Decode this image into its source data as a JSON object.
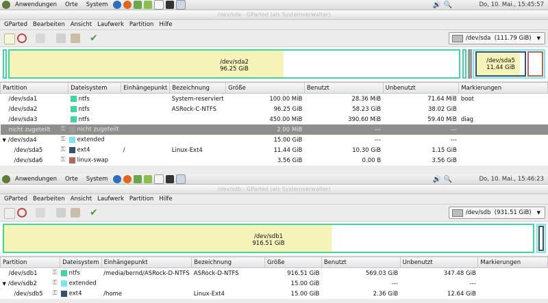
{
  "panel1": {
    "apps": "Anwendungen",
    "places": "Orte",
    "system": "System",
    "clock": "Do, 10. Mai., 15:45:57"
  },
  "window1": {
    "title": "/dev/sda - GParted (als Systemverwalter)",
    "menu": [
      "GParted",
      "Bearbeiten",
      "Ansicht",
      "Laufwerk",
      "Partition",
      "Hilfe"
    ],
    "device_selector": "/dev/sda",
    "device_size": "(111.79 GiB)",
    "disk_map": {
      "sda2_label": "/dev/sda2",
      "sda2_size": "96.25 GiB",
      "sda5_label": "/dev/sda5",
      "sda5_size": "11.44 GiB"
    },
    "columns": [
      "Partition",
      "Dateisystem",
      "Einhängepunkt",
      "Bezeichnung",
      "Größe",
      "Benutzt",
      "Unbenutzt",
      "Markierungen"
    ],
    "rows": [
      {
        "partition": "/dev/sda1",
        "fs": "ntfs",
        "fs_color": "#3ed89e",
        "mount": "",
        "label": "System-reserviert",
        "size": "100.00 MiB",
        "used": "28.36 MiB",
        "unused": "71.64 MiB",
        "flags": "boot"
      },
      {
        "partition": "/dev/sda2",
        "fs": "ntfs",
        "fs_color": "#3ed89e",
        "mount": "",
        "label": "ASRock-C-NTFS",
        "size": "96.25 GiB",
        "used": "58.23 GiB",
        "unused": "38.02 GiB",
        "flags": ""
      },
      {
        "partition": "/dev/sda3",
        "fs": "ntfs",
        "fs_color": "#3ed89e",
        "mount": "",
        "label": "",
        "size": "450.00 MiB",
        "used": "390.60 MiB",
        "unused": "59.40 MiB",
        "flags": "diag"
      },
      {
        "partition": "nicht zugeteilt",
        "fs": "nicht zugeteilt",
        "fs_color": "#9a9a96",
        "mount": "",
        "label": "",
        "size": "2.00 MiB",
        "used": "---",
        "unused": "---",
        "flags": ""
      },
      {
        "partition": "/dev/sda4",
        "fs": "extended",
        "fs_color": "#7be6f2",
        "mount": "",
        "label": "",
        "size": "15.00 GiB",
        "used": "---",
        "unused": "---",
        "flags": ""
      },
      {
        "partition": "/dev/sda5",
        "fs": "ext4",
        "fs_color": "#33506e",
        "mount": "/",
        "label": "Linux-Ext4",
        "size": "11.44 GiB",
        "used": "10.30 GiB",
        "unused": "1.15 GiB",
        "flags": ""
      },
      {
        "partition": "/dev/sda6",
        "fs": "linux-swap",
        "fs_color": "#b96458",
        "mount": "",
        "label": "",
        "size": "3.56 GiB",
        "used": "0.00 B",
        "unused": "3.56 GiB",
        "flags": ""
      }
    ]
  },
  "panel2": {
    "apps": "Anwendungen",
    "places": "Orte",
    "system": "System",
    "clock": "Do, 10. Mai., 15:46:23"
  },
  "window2": {
    "title": "/dev/sdb - GParted (als Systemverwalter)",
    "menu": [
      "GParted",
      "Bearbeiten",
      "Ansicht",
      "Laufwerk",
      "Partition",
      "Hilfe"
    ],
    "device_selector": "/dev/sdb",
    "device_size": "(931.51 GiB)",
    "disk_map": {
      "sdb1_label": "/dev/sdb1",
      "sdb1_size": "916.51 GiB"
    },
    "columns": [
      "Partition",
      "Dateisystem",
      "Einhängepunkt",
      "Bezeichnung",
      "Größe",
      "Benutzt",
      "Unbenutzt",
      "Markierungen"
    ],
    "rows": [
      {
        "partition": "/dev/sdb1",
        "fs": "ntfs",
        "fs_color": "#3ed89e",
        "mount": "/media/bernd/ASRock-D-NTFS",
        "label": "ASRock-D-NTFS",
        "size": "916.51 GiB",
        "used": "569.03 GiB",
        "unused": "347.48 GiB",
        "flags": ""
      },
      {
        "partition": "/dev/sdb2",
        "fs": "extended",
        "fs_color": "#7be6f2",
        "mount": "",
        "label": "",
        "size": "15.00 GiB",
        "used": "---",
        "unused": "---",
        "flags": ""
      },
      {
        "partition": "/dev/sdb5",
        "fs": "ext4",
        "fs_color": "#33506e",
        "mount": "/home",
        "label": "Linux-Ext4",
        "size": "15.00 GiB",
        "used": "2.36 GiB",
        "unused": "12.64 GiB",
        "flags": ""
      }
    ]
  },
  "colors": {
    "ntfs": "#3ed89e",
    "ntfs_used": "#f5f3b8",
    "extended": "#7be6f2",
    "ext4": "#33506e",
    "swap": "#b96458"
  }
}
